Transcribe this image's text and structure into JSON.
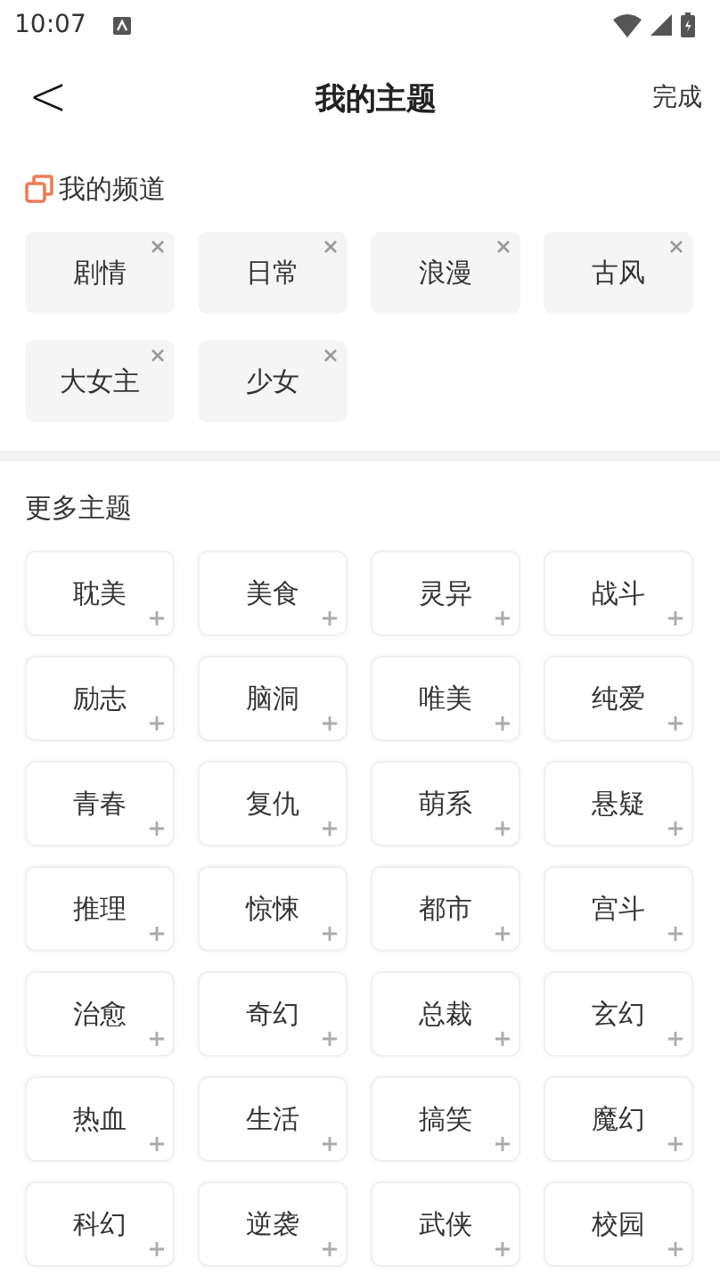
{
  "status_bar": {
    "time": "10:07"
  },
  "header": {
    "back": "<",
    "title": "我的主题",
    "action": "完成"
  },
  "my_channels": {
    "title": "我的频道",
    "items": [
      "剧情",
      "日常",
      "浪漫",
      "古风",
      "大女主",
      "少女"
    ]
  },
  "more_topics": {
    "title": "更多主题",
    "items": [
      "耽美",
      "美食",
      "灵异",
      "战斗",
      "励志",
      "脑洞",
      "唯美",
      "纯爱",
      "青春",
      "复仇",
      "萌系",
      "悬疑",
      "推理",
      "惊悚",
      "都市",
      "宫斗",
      "治愈",
      "奇幻",
      "总裁",
      "玄幻",
      "热血",
      "生活",
      "搞笑",
      "魔幻",
      "科幻",
      "逆袭",
      "武侠",
      "校园"
    ]
  }
}
